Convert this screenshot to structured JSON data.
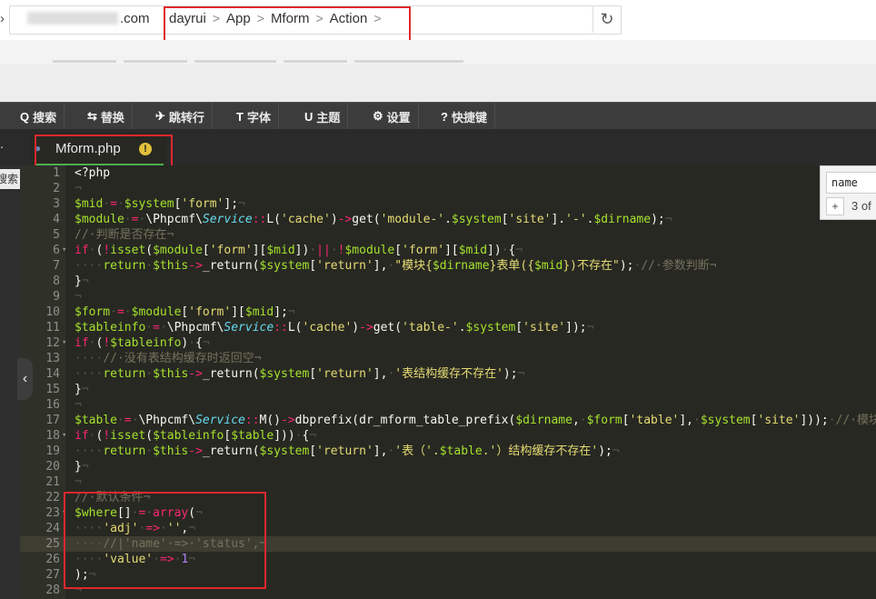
{
  "address_bar": {
    "domain_suffix": ".com",
    "breadcrumbs": [
      "dayrui",
      "App",
      "Mform",
      "Action"
    ],
    "separator": ">",
    "refresh_icon": "reload-icon"
  },
  "toolbar": {
    "items": [
      {
        "icon": "Q",
        "label": "搜索"
      },
      {
        "icon": "⇆",
        "label": "替换"
      },
      {
        "icon": "✈",
        "label": "跳转行"
      },
      {
        "icon": "T",
        "label": "字体"
      },
      {
        "icon": "U",
        "label": "主题"
      },
      {
        "icon": "⚙",
        "label": "设置"
      },
      {
        "icon": "?",
        "label": "快捷键"
      }
    ]
  },
  "side_panel": {
    "label": "搜索"
  },
  "file_tab": {
    "name": "Mform.php",
    "warning": "!"
  },
  "find_box": {
    "query": "name",
    "plus": "+",
    "match_count": "3 of"
  },
  "editor": {
    "active_line": 25,
    "lines": [
      {
        "no": "1",
        "fold": "",
        "html": "&lt;?php"
      },
      {
        "no": "2",
        "fold": "",
        "html": "<span class='ws'>¬</span>"
      },
      {
        "no": "3",
        "fold": "",
        "html": "<span class='v'>$mid</span><span class='ws'>·</span><span class='k'>=</span><span class='ws'>·</span><span class='v'>$system</span>[<span class='s'>'form'</span>];<span class='ws'>¬</span>"
      },
      {
        "no": "4",
        "fold": "",
        "html": "<span class='v'>$module</span><span class='ws'>·</span><span class='k'>=</span><span class='ws'>·</span>\\Phpcmf\\<span class='cls'>Service</span><span class='k'>::</span>L(<span class='s'>'cache'</span>)<span class='k'>-&gt;</span>get(<span class='s'>'module-'</span>.<span class='v'>$system</span>[<span class='s'>'site'</span>].<span class='s'>'-'</span>.<span class='v'>$dirname</span>);<span class='ws'>¬</span>"
      },
      {
        "no": "5",
        "fold": "",
        "html": "<span class='c'>//·判断是否存在¬</span>"
      },
      {
        "no": "6",
        "fold": "▾",
        "html": "<span class='k'>if</span><span class='ws'>·</span>(<span class='k'>!</span><span class='v'>isset</span>(<span class='v'>$module</span>[<span class='s'>'form'</span>][<span class='v'>$mid</span>])<span class='ws'>·</span><span class='k'>||</span><span class='ws'>·</span><span class='k'>!</span><span class='v'>$module</span>[<span class='s'>'form'</span>][<span class='v'>$mid</span>])<span class='ws'>·</span>{<span class='ws'>¬</span>"
      },
      {
        "no": "7",
        "fold": "",
        "html": "<span class='ws'>····</span><span class='v'>return</span><span class='ws'>·</span><span class='v'>$this</span><span class='k'>-&gt;</span>_return(<span class='v'>$system</span>[<span class='s'>'return'</span>],<span class='ws'>·</span><span class='s'>\"模块{<span class='v'>$dirname</span>}表单({<span class='v'>$mid</span>})不存在\"</span>);<span class='ws'>·</span><span class='c'>//·参数判断¬</span>"
      },
      {
        "no": "8",
        "fold": "",
        "html": "}<span class='ws'>¬</span>"
      },
      {
        "no": "9",
        "fold": "",
        "html": "<span class='ws'>¬</span>"
      },
      {
        "no": "10",
        "fold": "",
        "html": "<span class='v'>$form</span><span class='ws'>·</span><span class='k'>=</span><span class='ws'>·</span><span class='v'>$module</span>[<span class='s'>'form'</span>][<span class='v'>$mid</span>];<span class='ws'>¬</span>"
      },
      {
        "no": "11",
        "fold": "",
        "html": "<span class='v'>$tableinfo</span><span class='ws'>·</span><span class='k'>=</span><span class='ws'>·</span>\\Phpcmf\\<span class='cls'>Service</span><span class='k'>::</span>L(<span class='s'>'cache'</span>)<span class='k'>-&gt;</span>get(<span class='s'>'table-'</span>.<span class='v'>$system</span>[<span class='s'>'site'</span>]);<span class='ws'>¬</span>"
      },
      {
        "no": "12",
        "fold": "▾",
        "html": "<span class='k'>if</span><span class='ws'>·</span>(<span class='k'>!</span><span class='v'>$tableinfo</span>)<span class='ws'>·</span>{<span class='ws'>¬</span>"
      },
      {
        "no": "13",
        "fold": "",
        "html": "<span class='ws'>····</span><span class='c'>//·没有表结构缓存时返回空¬</span>"
      },
      {
        "no": "14",
        "fold": "",
        "html": "<span class='ws'>····</span><span class='v'>return</span><span class='ws'>·</span><span class='v'>$this</span><span class='k'>-&gt;</span>_return(<span class='v'>$system</span>[<span class='s'>'return'</span>],<span class='ws'>·</span><span class='s'>'表结构缓存不存在'</span>);<span class='ws'>¬</span>"
      },
      {
        "no": "15",
        "fold": "",
        "html": "}<span class='ws'>¬</span>"
      },
      {
        "no": "16",
        "fold": "",
        "html": "<span class='ws'>¬</span>"
      },
      {
        "no": "17",
        "fold": "",
        "html": "<span class='v'>$table</span><span class='ws'>·</span><span class='k'>=</span><span class='ws'>·</span>\\Phpcmf\\<span class='cls'>Service</span><span class='k'>::</span>M()<span class='k'>-&gt;</span>dbprefix(dr_mform_table_prefix(<span class='v'>$dirname</span>,<span class='ws'>·</span><span class='v'>$form</span>[<span class='s'>'table'</span>],<span class='ws'>·</span><span class='v'>$system</span>[<span class='s'>'site'</span>]));<span class='ws'>·</span><span class='c'>//·模块</span>"
      },
      {
        "no": "18",
        "fold": "▾",
        "html": "<span class='k'>if</span><span class='ws'>·</span>(<span class='k'>!</span><span class='v'>isset</span>(<span class='v'>$tableinfo</span>[<span class='v'>$table</span>]))<span class='ws'>·</span>{<span class='ws'>¬</span>"
      },
      {
        "no": "19",
        "fold": "",
        "html": "<span class='ws'>····</span><span class='v'>return</span><span class='ws'>·</span><span class='v'>$this</span><span class='k'>-&gt;</span>_return(<span class='v'>$system</span>[<span class='s'>'return'</span>],<span class='ws'>·</span><span class='s'>'表（'.</span><span class='v'>$table</span><span class='s'>.'）结构缓存不存在'</span>);<span class='ws'>¬</span>"
      },
      {
        "no": "20",
        "fold": "",
        "html": "}<span class='ws'>¬</span>"
      },
      {
        "no": "21",
        "fold": "",
        "html": "<span class='ws'>¬</span>"
      },
      {
        "no": "22",
        "fold": "",
        "html": "<span class='c'>//·默认条件¬</span>"
      },
      {
        "no": "23",
        "fold": "▾",
        "html": "<span class='v'>$where</span>[]<span class='ws'>·</span><span class='k'>=</span><span class='ws'>·</span><span class='k'>array</span>(<span class='ws'>¬</span>"
      },
      {
        "no": "24",
        "fold": "",
        "html": "<span class='ws'>····</span><span class='s'>'adj'</span><span class='ws'>·</span><span class='k'>=&gt;</span><span class='ws'>·</span><span class='s'>''</span>,<span class='ws'>¬</span>"
      },
      {
        "no": "25",
        "fold": "",
        "html": "<span class='ws'>····</span><span class='c'>//|'name'·=&gt;·'status',¬</span>"
      },
      {
        "no": "26",
        "fold": "",
        "html": "<span class='ws'>····</span><span class='s'>'value'</span><span class='ws'>·</span><span class='k'>=&gt;</span><span class='ws'>·</span><span class='n'>1</span><span class='ws'>¬</span>"
      },
      {
        "no": "27",
        "fold": "",
        "html": ");<span class='ws'>¬</span>"
      },
      {
        "no": "28",
        "fold": "",
        "html": "<span class='ws'>¬</span>"
      }
    ]
  }
}
